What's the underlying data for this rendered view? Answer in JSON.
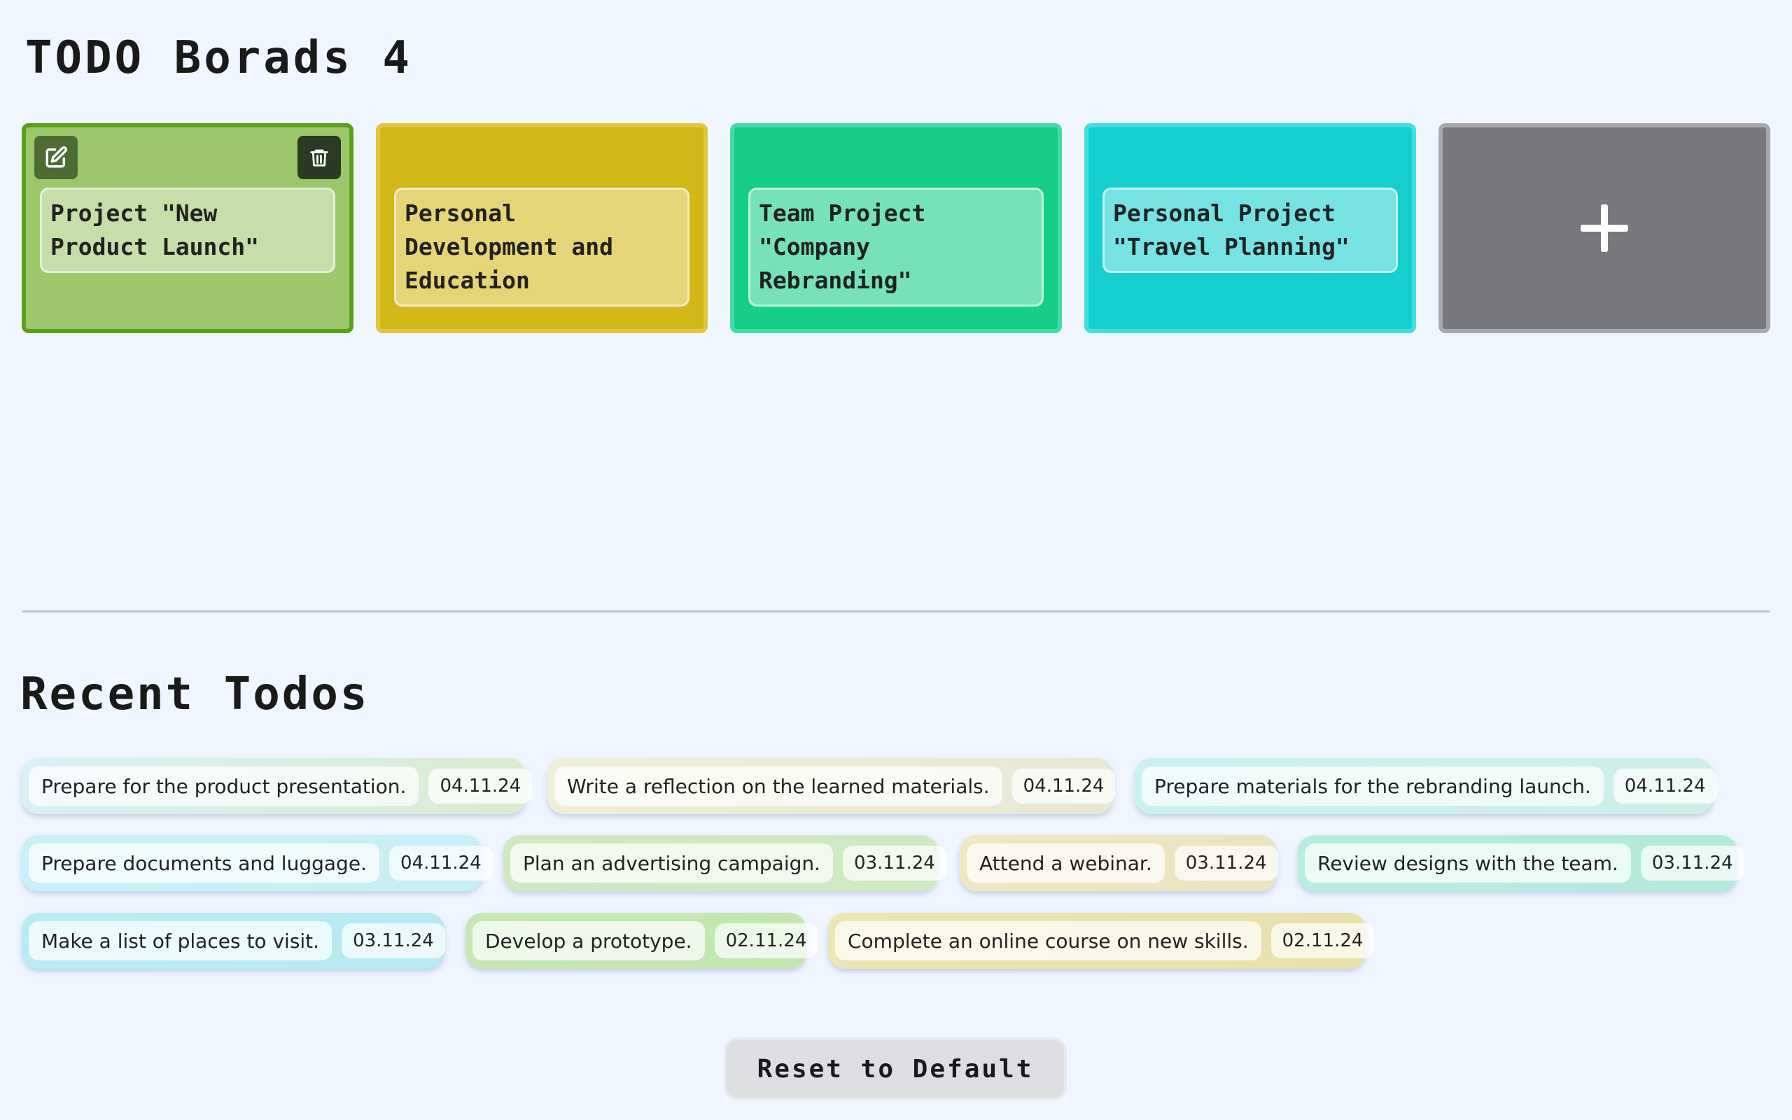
{
  "header": {
    "title": "TODO Borads 4"
  },
  "boards": [
    {
      "label": "Project \"New Product Launch\"",
      "active": true
    },
    {
      "label": "Personal Development and Education"
    },
    {
      "label": "Team Project \"Company Rebranding\""
    },
    {
      "label": "Personal Project \"Travel Planning\""
    }
  ],
  "add_board": {
    "icon": "plus-icon"
  },
  "board_actions": {
    "edit_icon": "edit-icon",
    "delete_icon": "trash-icon"
  },
  "colors": {
    "board1": "#9ec76b",
    "board2": "#d1b818",
    "board3": "#16cd88",
    "board4": "#14cfce",
    "add": "#77797e",
    "background": "#f0f6ff"
  },
  "recent": {
    "title": "Recent Todos",
    "items": [
      {
        "text": "Prepare for the product presentation.",
        "date": "04.11.24"
      },
      {
        "text": "Write a reflection on the learned materials.",
        "date": "04.11.24"
      },
      {
        "text": "Prepare materials for the rebranding launch.",
        "date": "04.11.24"
      },
      {
        "text": "Prepare documents and luggage.",
        "date": "04.11.24"
      },
      {
        "text": "Plan an advertising campaign.",
        "date": "03.11.24"
      },
      {
        "text": "Attend a webinar.",
        "date": "03.11.24"
      },
      {
        "text": "Review designs with the team.",
        "date": "03.11.24"
      },
      {
        "text": "Make a list of places to visit.",
        "date": "03.11.24"
      },
      {
        "text": "Develop a prototype.",
        "date": "02.11.24"
      },
      {
        "text": "Complete an online course on new skills.",
        "date": "02.11.24"
      }
    ]
  },
  "reset_button": {
    "label": "Reset to Default"
  }
}
